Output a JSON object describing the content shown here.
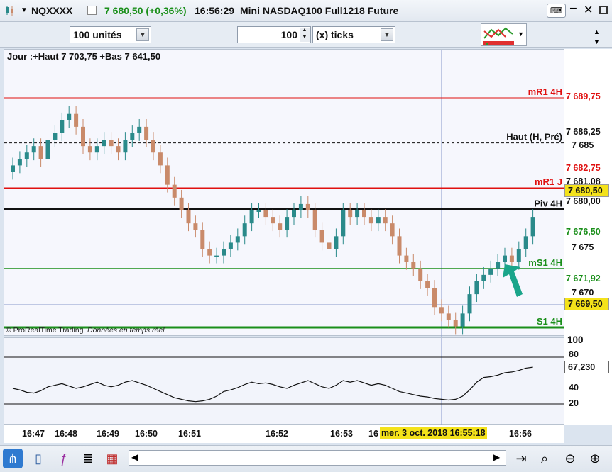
{
  "header": {
    "symbol": "NQXXXX",
    "price_change": "7 680,50 (+0,36%)",
    "time": "16:56:29",
    "instrument": "Mini NASDAQ100 Full1218 Future"
  },
  "toolbar": {
    "quantity": "100 unités",
    "ticks_value": "100",
    "ticks_unit": "(x) ticks"
  },
  "chart": {
    "info": "Jour :+Haut 7 703,75 +Bas 7 641,50",
    "footer_brand": "© ProRealTime Trading",
    "footer_status": "Données en temps réel",
    "levels": [
      {
        "label": "mR1 4H",
        "price": "7 689,75",
        "color": "#e01010"
      },
      {
        "label": "Haut (H, Pré)",
        "price": "7 686,25",
        "color": "#111111"
      },
      {
        "label": "mR1 J",
        "price": "7 682,75",
        "color": "#e01010"
      },
      {
        "label": "Piv 4H",
        "price": "7 681,08",
        "color": "#111111"
      },
      {
        "label": "mS1 4H",
        "price": "7 676,50",
        "color": "#1a8f1a"
      },
      {
        "label": "S1 4H",
        "price": "7 671,92",
        "color": "#1a8f1a"
      }
    ],
    "y_ticks": [
      "7 685",
      "7 675",
      "7 670"
    ],
    "current_price": "7 680,50",
    "current_price2": "7 680,00",
    "low_price": "7 669,50",
    "up_color": "#2a8a8a",
    "down_color": "#c98a6a"
  },
  "oscillator": {
    "value": "67,230",
    "y_ticks": [
      "100",
      "80",
      "60",
      "40",
      "20"
    ]
  },
  "x_axis": {
    "ticks": [
      "16:47",
      "16:48",
      "16:49",
      "16:50",
      "16:51",
      "16:52",
      "16:53",
      "16",
      "16:56"
    ],
    "cursor_label": "mer. 3 oct. 2018 16:55:18"
  },
  "chart_data": {
    "type": "candlestick",
    "title": "Mini NASDAQ100 Full1218 Future",
    "x_ticks": [
      "16:47",
      "16:48",
      "16:49",
      "16:50",
      "16:51",
      "16:52",
      "16:53",
      "16:56"
    ],
    "ylim": [
      7669,
      7692
    ],
    "close_series": [
      7684.5,
      7685.0,
      7685.5,
      7686.0,
      7685.0,
      7686.5,
      7687.0,
      7688.0,
      7688.5,
      7687.5,
      7686.0,
      7685.5,
      7686.0,
      7686.5,
      7686.0,
      7685.5,
      7686.5,
      7687.0,
      7687.5,
      7686.5,
      7685.5,
      7684.5,
      7683.0,
      7682.0,
      7681.0,
      7680.0,
      7679.5,
      7678.0,
      7677.5,
      7677.5,
      7678.0,
      7678.5,
      7679.0,
      7680.0,
      7681.0,
      7681.0,
      7680.5,
      7680.0,
      7679.5,
      7680.5,
      7681.0,
      7681.5,
      7681.0,
      7679.5,
      7678.5,
      7678.0,
      7679.0,
      7681.0,
      7680.5,
      7681.0,
      7680.5,
      7680.0,
      7680.5,
      7680.0,
      7679.0,
      7677.5,
      7677.0,
      7676.5,
      7675.5,
      7675.0,
      7673.5,
      7673.0,
      7672.5,
      7672.0,
      7673.0,
      7674.5,
      7675.5,
      7676.0,
      7676.5,
      7677.0,
      7677.5,
      7677.0,
      7678.0,
      7679.0,
      7680.5
    ],
    "oscillator_series": [
      40,
      38,
      35,
      34,
      37,
      42,
      44,
      46,
      43,
      40,
      42,
      45,
      48,
      44,
      42,
      44,
      48,
      50,
      47,
      44,
      40,
      36,
      32,
      28,
      26,
      24,
      23,
      24,
      26,
      30,
      36,
      38,
      41,
      45,
      48,
      46,
      47,
      45,
      42,
      40,
      44,
      47,
      50,
      46,
      42,
      40,
      44,
      50,
      48,
      50,
      47,
      44,
      46,
      44,
      40,
      36,
      34,
      32,
      30,
      29,
      27,
      26,
      25,
      26,
      30,
      38,
      48,
      54,
      55,
      57,
      60,
      61,
      63,
      66,
      67.2
    ],
    "series": [
      {
        "name": "mR1 4H",
        "values": [
          7689.75
        ]
      },
      {
        "name": "Haut (H, Pré)",
        "values": [
          7686.25
        ]
      },
      {
        "name": "mR1 J",
        "values": [
          7682.75
        ]
      },
      {
        "name": "Piv 4H",
        "values": [
          7681.08
        ]
      },
      {
        "name": "mS1 4H",
        "values": [
          7676.5
        ]
      },
      {
        "name": "S1 4H",
        "values": [
          7671.92
        ]
      }
    ]
  }
}
